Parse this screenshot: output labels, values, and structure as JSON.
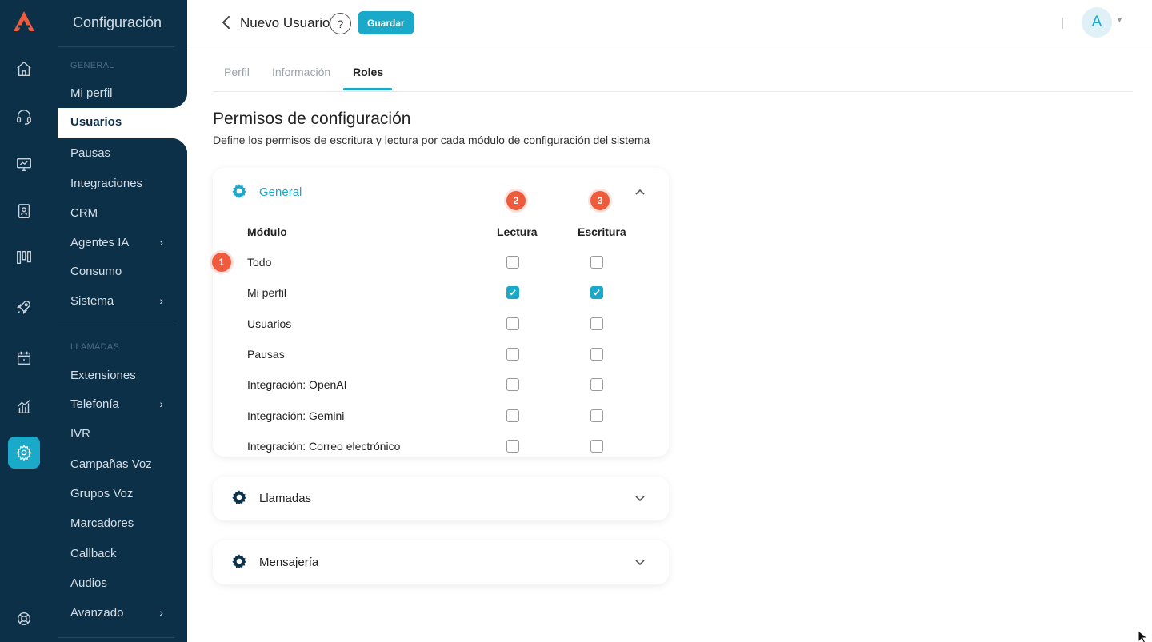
{
  "brand": {
    "accent": "#1ba9c9",
    "sidebar_bg": "#0d3049",
    "badge": "#ee5b3d"
  },
  "rail": {
    "logo": "app-logo",
    "icons": [
      "home-icon",
      "headset-icon",
      "monitor-icon",
      "contacts-book-icon",
      "kanban-icon",
      "rocket-icon",
      "calendar-icon",
      "bar-chart-icon",
      "gear-icon",
      "lifebuoy-icon"
    ],
    "active": "gear-icon"
  },
  "sidebar": {
    "title": "Configuración",
    "sections": [
      {
        "label": "GENERAL",
        "items": [
          {
            "label": "Mi perfil"
          },
          {
            "label": "Usuarios",
            "active": true
          },
          {
            "label": "Pausas"
          },
          {
            "label": "Integraciones"
          },
          {
            "label": "CRM"
          },
          {
            "label": "Agentes IA",
            "has_submenu": true
          },
          {
            "label": "Consumo"
          },
          {
            "label": "Sistema",
            "has_submenu": true
          }
        ]
      },
      {
        "label": "LLAMADAS",
        "items": [
          {
            "label": "Extensiones"
          },
          {
            "label": "Telefonía",
            "has_submenu": true
          },
          {
            "label": "IVR"
          },
          {
            "label": "Campañas Voz"
          },
          {
            "label": "Grupos Voz"
          },
          {
            "label": "Marcadores"
          },
          {
            "label": "Callback"
          },
          {
            "label": "Audios"
          },
          {
            "label": "Avanzado",
            "has_submenu": true
          }
        ]
      }
    ]
  },
  "header": {
    "title": "Nuevo Usuario",
    "help_label": "?",
    "save_label": "Guardar",
    "avatar_initial": "A"
  },
  "tabs": [
    {
      "label": "Perfil"
    },
    {
      "label": "Información"
    },
    {
      "label": "Roles",
      "active": true
    }
  ],
  "content": {
    "title": "Permisos de configuración",
    "description": "Define los permisos de escritura y lectura por cada módulo de configuración del sistema"
  },
  "groups": [
    {
      "title": "General",
      "expanded": true,
      "columns": {
        "module": "Módulo",
        "read": "Lectura",
        "write": "Escritura"
      },
      "badges": {
        "row": "1",
        "read": "2",
        "write": "3"
      },
      "rows": [
        {
          "label": "Todo",
          "read": false,
          "write": false
        },
        {
          "label": "Mi perfil",
          "read": true,
          "write": true
        },
        {
          "label": "Usuarios",
          "read": false,
          "write": false
        },
        {
          "label": "Pausas",
          "read": false,
          "write": false
        },
        {
          "label": "Integración: OpenAI",
          "read": false,
          "write": false
        },
        {
          "label": "Integración: Gemini",
          "read": false,
          "write": false
        },
        {
          "label": "Integración: Correo electrónico",
          "read": false,
          "write": false
        }
      ]
    },
    {
      "title": "Llamadas",
      "expanded": false
    },
    {
      "title": "Mensajería",
      "expanded": false
    }
  ]
}
